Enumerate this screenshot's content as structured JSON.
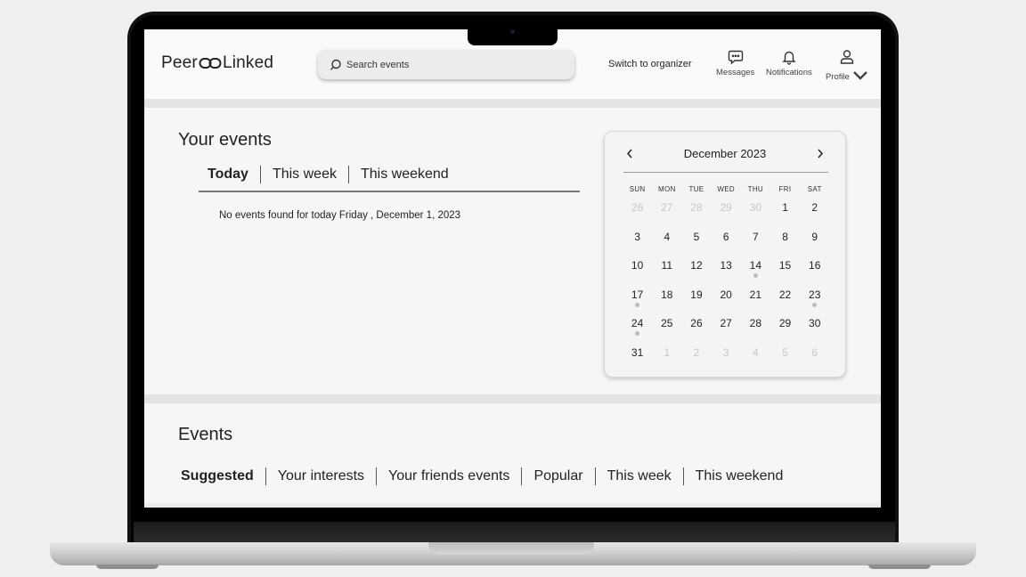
{
  "app": {
    "logo_left": "Peer",
    "logo_right": "Linked"
  },
  "navbar": {
    "search_placeholder": "Search events",
    "switch_label": "Switch to organizer",
    "messages_label": "Messages",
    "notifications_label": "Notifications",
    "profile_label": "Profile"
  },
  "your_events": {
    "title": "Your events",
    "tabs": [
      "Today",
      "This week",
      "This weekend"
    ],
    "active_tab": "Today",
    "empty_message": "No events found for today Friday , December 1, 2023"
  },
  "calendar": {
    "month_label": "December 2023",
    "weekdays": [
      "SUN",
      "MON",
      "TUE",
      "WED",
      "THU",
      "FRI",
      "SAT"
    ],
    "days": [
      {
        "n": "26",
        "muted": true
      },
      {
        "n": "27",
        "muted": true
      },
      {
        "n": "28",
        "muted": true
      },
      {
        "n": "29",
        "muted": true
      },
      {
        "n": "30",
        "muted": true
      },
      {
        "n": "1"
      },
      {
        "n": "2"
      },
      {
        "n": "3"
      },
      {
        "n": "4"
      },
      {
        "n": "5"
      },
      {
        "n": "6"
      },
      {
        "n": "7"
      },
      {
        "n": "8"
      },
      {
        "n": "9"
      },
      {
        "n": "10"
      },
      {
        "n": "11"
      },
      {
        "n": "12"
      },
      {
        "n": "13"
      },
      {
        "n": "14",
        "dot": true
      },
      {
        "n": "15"
      },
      {
        "n": "16"
      },
      {
        "n": "17",
        "dot": true
      },
      {
        "n": "18"
      },
      {
        "n": "19"
      },
      {
        "n": "20"
      },
      {
        "n": "21"
      },
      {
        "n": "22"
      },
      {
        "n": "23",
        "dot": true
      },
      {
        "n": "24",
        "dot": true
      },
      {
        "n": "25"
      },
      {
        "n": "26"
      },
      {
        "n": "27"
      },
      {
        "n": "28"
      },
      {
        "n": "29"
      },
      {
        "n": "30"
      },
      {
        "n": "31"
      },
      {
        "n": "1",
        "muted": true
      },
      {
        "n": "2",
        "muted": true
      },
      {
        "n": "3",
        "muted": true
      },
      {
        "n": "4",
        "muted": true
      },
      {
        "n": "5",
        "muted": true
      },
      {
        "n": "6",
        "muted": true
      }
    ]
  },
  "events": {
    "title": "Events",
    "tabs": [
      "Suggested",
      "Your interests",
      "Your friends events",
      "Popular",
      "This week",
      "This weekend"
    ],
    "active_tab": "Suggested"
  }
}
